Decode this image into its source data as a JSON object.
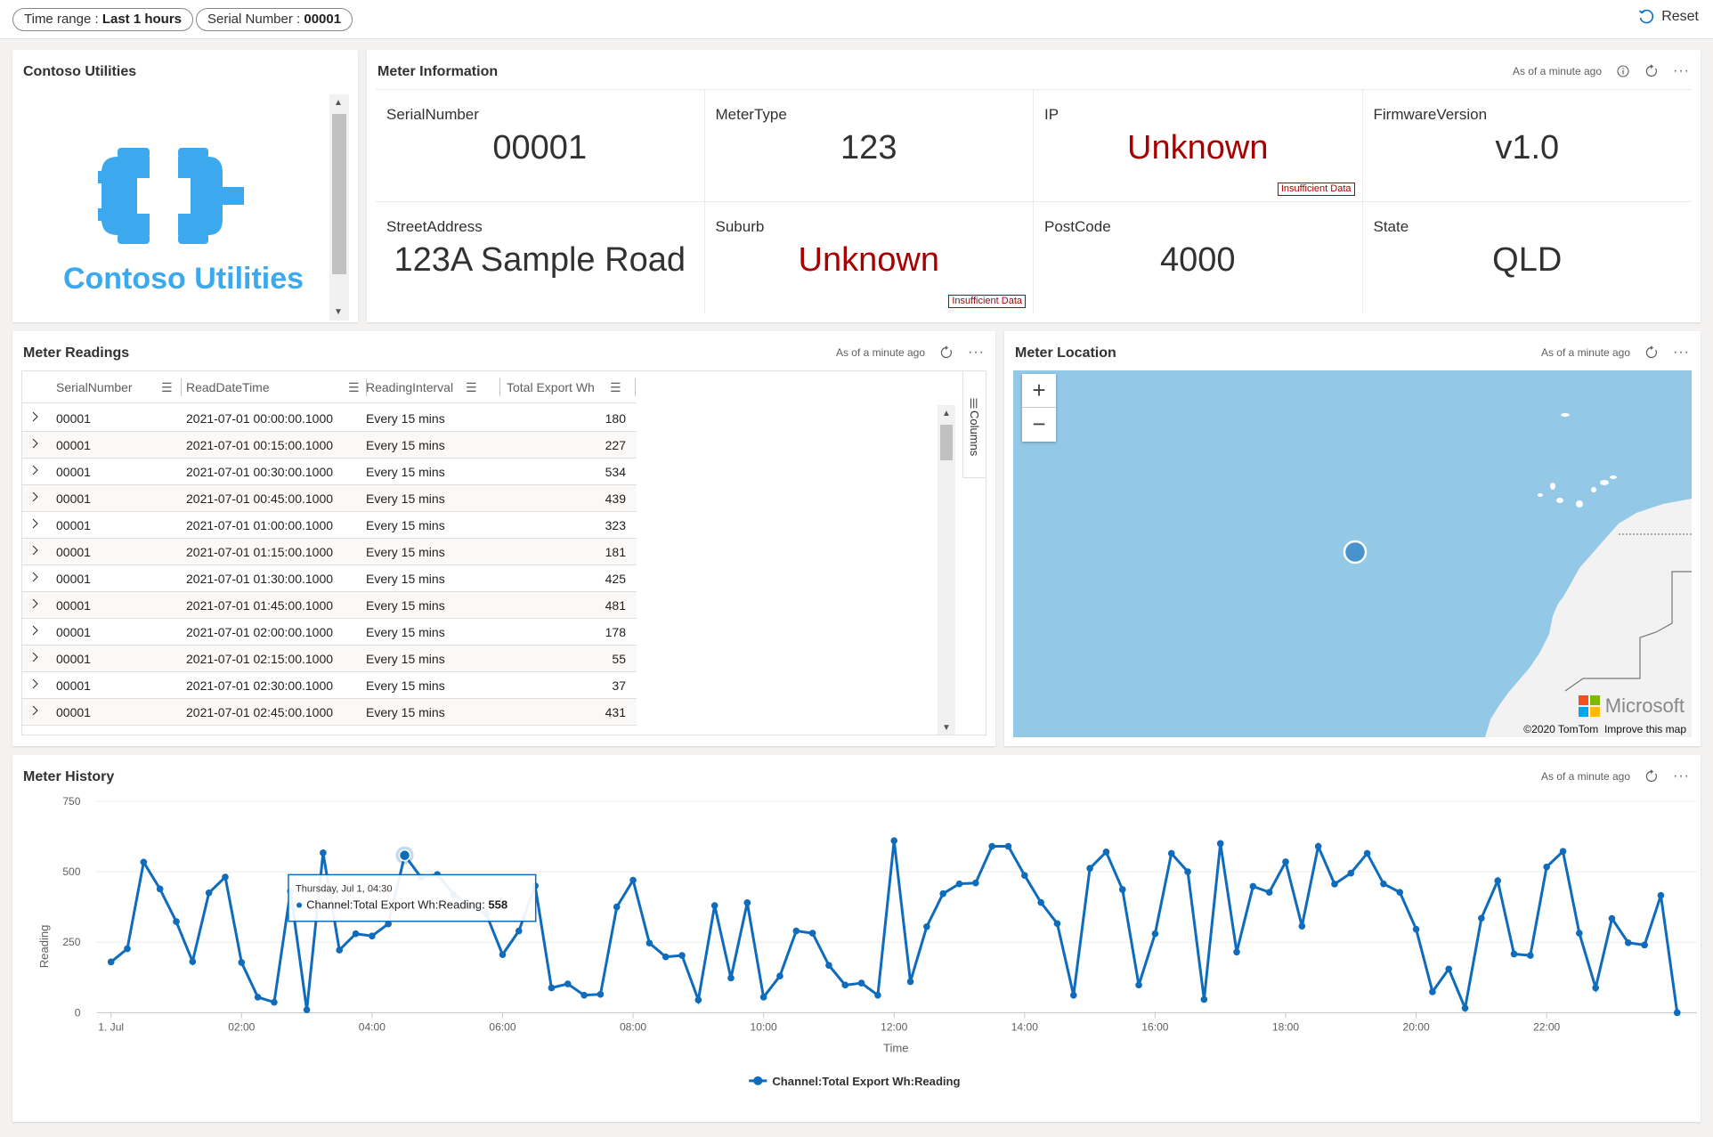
{
  "filters": {
    "time_range_label": "Time range : ",
    "time_range_value": "Last 1 hours",
    "serial_label": "Serial Number : ",
    "serial_value": "00001",
    "reset": "Reset"
  },
  "logo_panel": {
    "title": "Contoso Utilities",
    "logo_text": "Contoso Utilities"
  },
  "meter_info": {
    "title": "Meter Information",
    "as_of": "As of a minute ago",
    "cells": [
      {
        "label": "SerialNumber",
        "value": "00001"
      },
      {
        "label": "MeterType",
        "value": "123"
      },
      {
        "label": "IP",
        "value": "Unknown",
        "tag": "Insufficient Data"
      },
      {
        "label": "FirmwareVersion",
        "value": "v1.0"
      },
      {
        "label": "StreetAddress",
        "value": "123A Sample Road"
      },
      {
        "label": "Suburb",
        "value": "Unknown",
        "tag": "Insufficient Data"
      },
      {
        "label": "PostCode",
        "value": "4000"
      },
      {
        "label": "State",
        "value": "QLD"
      }
    ]
  },
  "readings": {
    "title": "Meter Readings",
    "as_of": "As of a minute ago",
    "columns": [
      "SerialNumber",
      "ReadDateTime",
      "ReadingInterval",
      "Total Export Wh"
    ],
    "side_label": "Columns",
    "rows": [
      [
        "00001",
        "2021-07-01 00:00:00.1000",
        "Every 15 mins",
        "180"
      ],
      [
        "00001",
        "2021-07-01 00:15:00.1000",
        "Every 15 mins",
        "227"
      ],
      [
        "00001",
        "2021-07-01 00:30:00.1000",
        "Every 15 mins",
        "534"
      ],
      [
        "00001",
        "2021-07-01 00:45:00.1000",
        "Every 15 mins",
        "439"
      ],
      [
        "00001",
        "2021-07-01 01:00:00.1000",
        "Every 15 mins",
        "323"
      ],
      [
        "00001",
        "2021-07-01 01:15:00.1000",
        "Every 15 mins",
        "181"
      ],
      [
        "00001",
        "2021-07-01 01:30:00.1000",
        "Every 15 mins",
        "425"
      ],
      [
        "00001",
        "2021-07-01 01:45:00.1000",
        "Every 15 mins",
        "481"
      ],
      [
        "00001",
        "2021-07-01 02:00:00.1000",
        "Every 15 mins",
        "178"
      ],
      [
        "00001",
        "2021-07-01 02:15:00.1000",
        "Every 15 mins",
        "55"
      ],
      [
        "00001",
        "2021-07-01 02:30:00.1000",
        "Every 15 mins",
        "37"
      ],
      [
        "00001",
        "2021-07-01 02:45:00.1000",
        "Every 15 mins",
        "431"
      ]
    ]
  },
  "location": {
    "title": "Meter Location",
    "as_of": "As of a minute ago",
    "zoom_in": "+",
    "zoom_out": "−",
    "brand": "Microsoft",
    "copyright": "©2020 TomTom",
    "improve": "Improve this map"
  },
  "history": {
    "title": "Meter History",
    "as_of": "As of a minute ago",
    "tooltip": {
      "date": "Thursday, Jul 1, 04:30",
      "series": "Channel:Total Export Wh:Reading: ",
      "value": "558"
    }
  },
  "colors": {
    "series": "#0f6cbd",
    "error": "#a80000",
    "logo": "#3ca9ef",
    "water": "#93c9e6",
    "land": "#f2f2f2"
  },
  "chart_data": {
    "type": "line",
    "title": "",
    "xlabel": "Time",
    "ylabel": "Reading",
    "ylim": [
      0,
      750
    ],
    "yticks": [
      0,
      250,
      500,
      750
    ],
    "x_tick_labels": [
      "1. Jul",
      "02:00",
      "04:00",
      "06:00",
      "08:00",
      "10:00",
      "12:00",
      "14:00",
      "16:00",
      "18:00",
      "20:00",
      "22:00"
    ],
    "x_start_hour": 0,
    "x_step_minutes": 15,
    "legend": "bottom",
    "series": [
      {
        "name": "Channel:Total Export Wh:Reading",
        "values": [
          180,
          227,
          534,
          439,
          323,
          181,
          425,
          481,
          178,
          55,
          37,
          431,
          10,
          567,
          222,
          280,
          272,
          315,
          558,
          480,
          490,
          420,
          380,
          350,
          206,
          290,
          450,
          88,
          102,
          62,
          65,
          375,
          470,
          247,
          198,
          203,
          45,
          380,
          123,
          390,
          55,
          130,
          290,
          282,
          168,
          98,
          105,
          62,
          610,
          110,
          305,
          422,
          457,
          460,
          590,
          590,
          487,
          391,
          316,
          62,
          512,
          570,
          437,
          98,
          280,
          565,
          500,
          47,
          600,
          215,
          448,
          427,
          535,
          307,
          590,
          456,
          495,
          565,
          457,
          427,
          296,
          74,
          155,
          16,
          335,
          468,
          208,
          203,
          517,
          572,
          282,
          88,
          334,
          248,
          240,
          416,
          0
        ]
      }
    ]
  }
}
